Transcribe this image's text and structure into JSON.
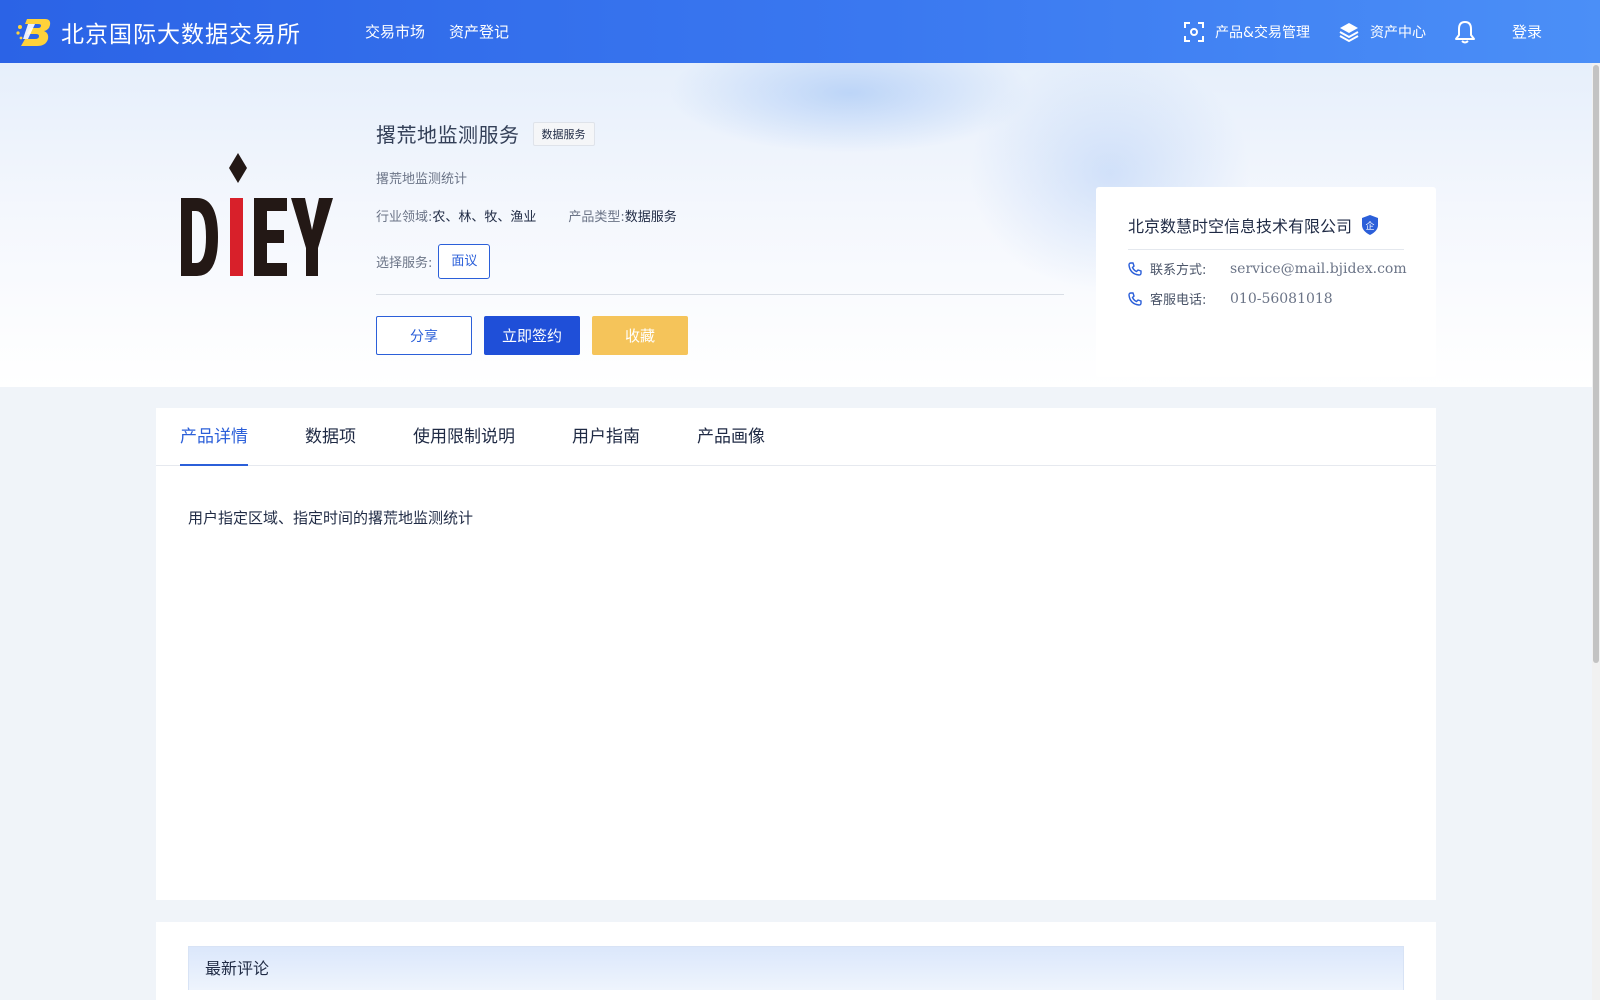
{
  "header": {
    "brand_name": "北京国际大数据交易所",
    "nav": [
      "交易市场",
      "资产登记"
    ],
    "product_mgmt": "产品&交易管理",
    "asset_center": "资产中心",
    "login": "登录"
  },
  "product": {
    "logo_text": "DIEY",
    "title": "撂荒地监测服务",
    "tag": "数据服务",
    "subtitle": "撂荒地监测统计",
    "industry_label": "行业领域:",
    "industry_value": "农、林、牧、渔业",
    "type_label": "产品类型:",
    "type_value": "数据服务",
    "service_label": "选择服务:",
    "service_option": "面议",
    "buttons": {
      "share": "分享",
      "sign": "立即签约",
      "favorite": "收藏"
    }
  },
  "seller": {
    "name": "北京数慧时空信息技术有限公司",
    "badge": "企",
    "contact_label": "联系方式:",
    "contact_value": "service@mail.bjidex.com",
    "phone_label": "客服电话:",
    "phone_value": "010-56081018"
  },
  "tabs": [
    "产品详情",
    "数据项",
    "使用限制说明",
    "用户指南",
    "产品画像"
  ],
  "active_tab": "产品详情",
  "detail_text": "用户指定区域、指定时间的撂荒地监测统计",
  "comments": {
    "title": "最新评论"
  },
  "colors": {
    "primary": "#1f4fd8",
    "accent_yellow": "#f5c45a",
    "topbar_start": "#2b63e6",
    "topbar_end": "#4b8ff7",
    "logo_red": "#d8202a",
    "logo_dark": "#231815"
  }
}
